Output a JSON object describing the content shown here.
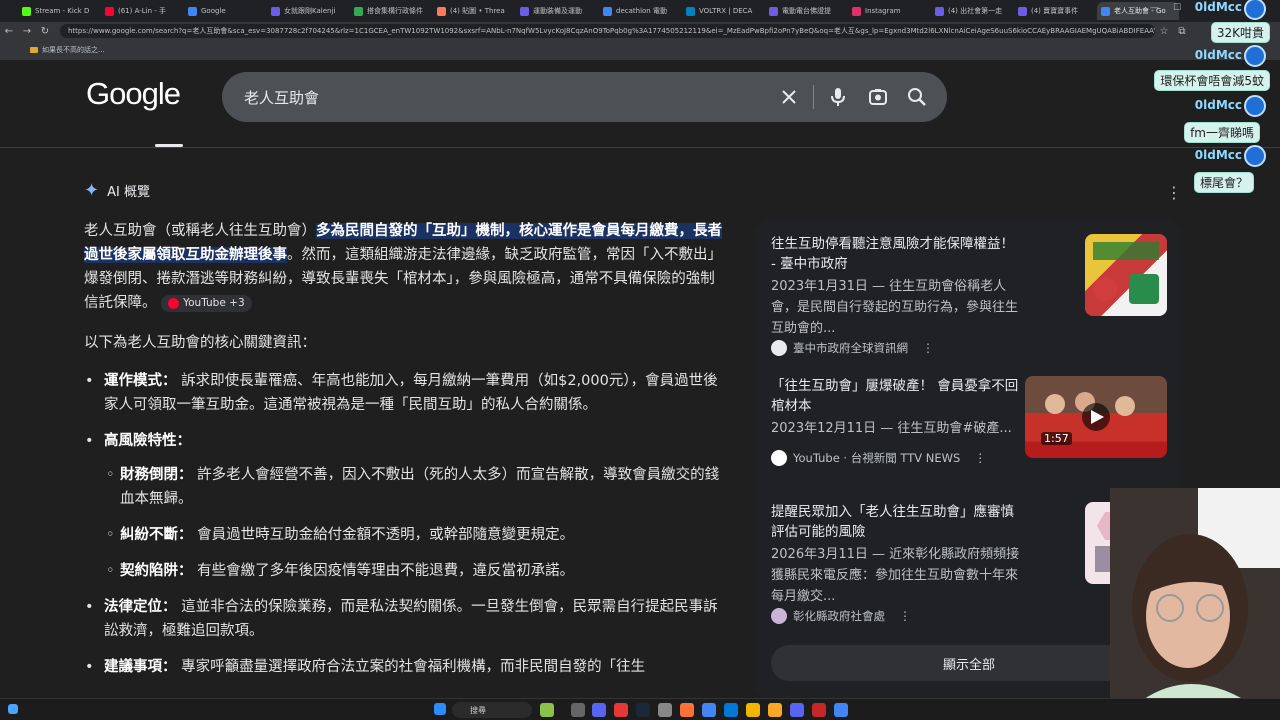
{
  "browser": {
    "tabs": [
      {
        "label": "Stream - Kick D",
        "color": "#53fc18"
      },
      {
        "label": "(61) A-Lin - 手",
        "color": "#ff0033"
      },
      {
        "label": "Google",
        "color": "#4285f4"
      },
      {
        "label": "女就跟剛Kalenji",
        "color": "#6c5ce7"
      },
      {
        "label": "搭食集構行政條件",
        "color": "#34a853"
      },
      {
        "label": "(4) 貼圖 • Threa",
        "color": "#ff7a59"
      },
      {
        "label": "運動裝備及運動",
        "color": "#6c5ce7"
      },
      {
        "label": "decathlon 電動",
        "color": "#4285f4"
      },
      {
        "label": "VOLTRX | DECA",
        "color": "#0082c3"
      },
      {
        "label": "電動電台佛證提",
        "color": "#6c5ce7"
      },
      {
        "label": "Instagram",
        "color": "#e1306c"
      },
      {
        "label": "(4) 出社會第一走",
        "color": "#6c5ce7"
      },
      {
        "label": "(4) 賣寶寶事件",
        "color": "#6c5ce7"
      },
      {
        "label": "老人互助會 - Go",
        "color": "#4285f4"
      }
    ],
    "url": "https://www.google.com/search?q=老人互助會&sca_esv=3087728c2f704245&rlz=1C1GCEA_enTW1092TW1092&sxsrf=ANbL-n7NqfW5LvycKoJ8CqzAnO9ToPqb0g%3A1774505212119&ei=_MzEadPwBpfi2oPn7yBeQ&oq=老人互&gs_lp=Egxnd3Mtd2l6LXNlcnAiCeiAgeS6uuS6kioCCAEyBRAAGIAEMgUQABiABDIFEAAY...",
    "bookmark": "如果長不高的話之..."
  },
  "google": {
    "logo": "Google",
    "query": "老人互助會"
  },
  "ai_overview": {
    "label": "AI 概覽",
    "p1_pre": "老人互助會（或稱老人往生互助會）",
    "p1_hl": "多為民間自發的「互助」機制，核心運作是會員每月繳費，長者過世後家屬領取互助金辦理後事",
    "p1_post": "。然而，這類組織游走法律邊緣，缺乏政府監管，常因「入不敷出」爆發倒閉、捲款潛逃等財務糾紛，導致長輩喪失「棺材本」，參與風險極高，通常不具備保險的強制信託保障。",
    "p1_src": "YouTube +3",
    "p2": "以下為老人互助會的核心關鍵資訊：",
    "b1_title": "運作模式：",
    "b1_text": "訴求即使長輩罹癌、年高也能加入，每月繳納一筆費用（如$2,000元），會員過世後家人可領取一筆互助金。這通常被視為是一種「民間互助」的私人合約關係。",
    "b2_title": "高風險特性：",
    "s1_title": "財務倒閉：",
    "s1_text": "許多老人會經營不善，因入不敷出（死的人太多）而宣告解散，導致會員繳交的錢血本無歸。",
    "s2_title": "糾紛不斷：",
    "s2_text": "會員過世時互助金給付金額不透明，或幹部隨意變更規定。",
    "s3_title": "契約陷阱：",
    "s3_text": "有些會繳了多年後因疫情等理由不能退費，違反當初承諾。",
    "b3_title": "法律定位：",
    "b3_text": "這並非合法的保險業務，而是私法契約關係。一旦發生倒會，民眾需自行提起民事訴訟救濟，極難追回款項。",
    "b4_title": "建議事項：",
    "b4_text": "專家呼籲盡量選擇政府合法立案的社會福利機構，而非民間自發的「往生"
  },
  "sources": {
    "cards": [
      {
        "title": "往生互助停看聽注意風險才能保障權益！ - 臺中市政府",
        "snippet": "2023年1月31日 — 往生互助會俗稱老人會，是民間自行發起的互助行為，參與往生互助會的...",
        "source": "臺中市政府全球資訊網"
      },
      {
        "title": "「往生互助會」屢爆破產！ 會員憂拿不回棺材本",
        "snippet": "2023年12月11日 — 往生互助會#破產...",
        "source": "YouTube · 台視新聞 TTV NEWS",
        "duration": "1:57"
      },
      {
        "title": "提醒民眾加入「老人往生互助會」應審慎評估可能的風險",
        "snippet": "2026年3月11日 — 近來彰化縣政府頻頻接獲縣民來電反應：參加往生互助會數十年來每月繳交...",
        "source": "彰化縣政府社會處"
      }
    ],
    "show_all": "顯示全部"
  },
  "chat": {
    "viewers": "32K咁貴",
    "username": "0ldMcc",
    "messages": [
      "環保杯會唔會減5蚊",
      "fm一齊睇嗎",
      "標尾會？"
    ]
  },
  "taskbar": {
    "search": "搜尋"
  }
}
